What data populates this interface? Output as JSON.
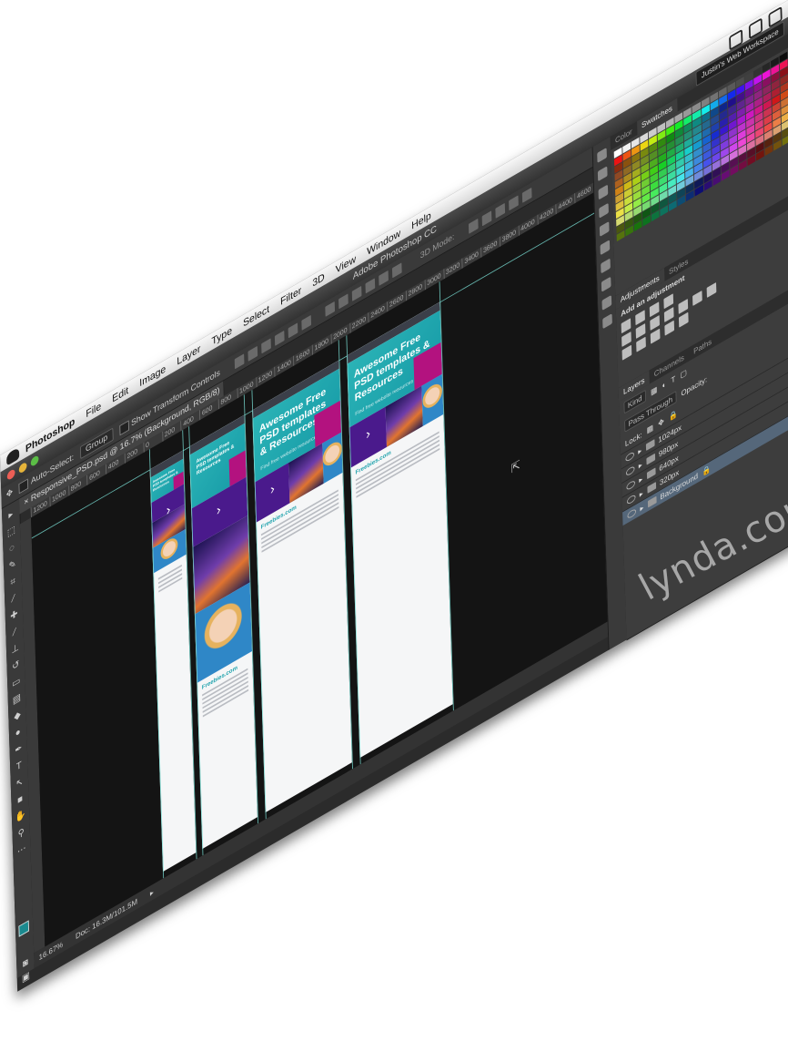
{
  "menubar": {
    "app_name": "Photoshop",
    "items": [
      "File",
      "Edit",
      "Image",
      "Layer",
      "Type",
      "Select",
      "Filter",
      "3D",
      "View",
      "Window",
      "Help"
    ]
  },
  "window": {
    "title": "Adobe Photoshop CC",
    "workspace": "Justin's Web Workspace"
  },
  "options_bar": {
    "auto_select_label": "Auto-Select:",
    "auto_select_value": "Group",
    "show_transform_label": "Show Transform Controls",
    "mode_3d_label": "3D Mode:"
  },
  "document": {
    "tab_title": "Responsive_PSD.psd @ 16.7% (Background, RGB/8)",
    "zoom": "16.67%",
    "doc_info": "Doc: 16.3M/101.5M"
  },
  "ruler_labels": [
    "1200",
    "1000",
    "800",
    "600",
    "400",
    "200",
    "0",
    "200",
    "400",
    "600",
    "800",
    "1000",
    "1200",
    "1400",
    "1600",
    "1800",
    "2000",
    "2200",
    "2400",
    "2600",
    "2800",
    "3000",
    "3200",
    "3400",
    "3600",
    "3800",
    "4000",
    "4200",
    "4400",
    "4600"
  ],
  "artboards": {
    "hero_title": "Awesome Free PSD templates & Resources",
    "hero_sub": "Find free website resources",
    "section_heading": "Freebies.com"
  },
  "panels": {
    "color_tab": "Color",
    "swatches_tab": "Swatches",
    "adjustments_tab": "Adjustments",
    "styles_tab": "Styles",
    "add_adjustment": "Add an adjustment",
    "layers_tab": "Layers",
    "channels_tab": "Channels",
    "paths_tab": "Paths",
    "kind_label": "Kind",
    "blend_mode": "Pass Through",
    "opacity_label": "Opacity:",
    "lock_label": "Lock:",
    "layers": [
      "1024px",
      "980px",
      "640px",
      "320px",
      "Background"
    ]
  },
  "watermark": "lynda.com",
  "colors": {
    "accent_teal": "#1b9fa9",
    "magenta": "#b3127f",
    "purple": "#4a1a8c",
    "selected_layer": "#55677a"
  }
}
